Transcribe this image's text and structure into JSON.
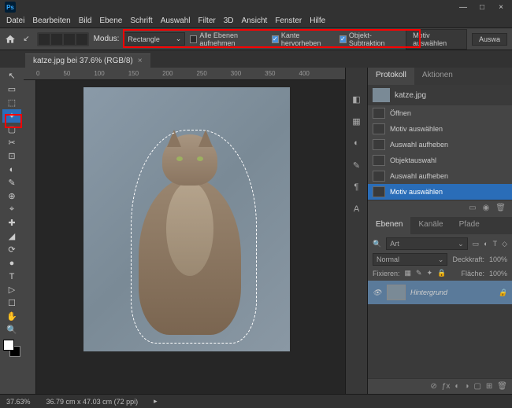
{
  "window": {
    "minimize": "—",
    "maximize": "□",
    "close": "×"
  },
  "menu": [
    "Datei",
    "Bearbeiten",
    "Bild",
    "Ebene",
    "Schrift",
    "Auswahl",
    "Filter",
    "3D",
    "Ansicht",
    "Fenster",
    "Hilfe"
  ],
  "optbar": {
    "mode_label": "Modus:",
    "mode_value": "Rectangle",
    "chk_all": "Alle Ebenen aufnehmen",
    "chk_edge": "Kante hervorheben",
    "chk_sub": "Objekt-Subtraktion",
    "btn_motiv": "Motiv auswählen",
    "btn_ausw": "Auswa"
  },
  "tab": {
    "title": "katze.jpg bei 37.6% (RGB/8)"
  },
  "ruler": [
    "0",
    "50",
    "100",
    "150",
    "200",
    "250",
    "300",
    "350",
    "400"
  ],
  "history": {
    "tabs": [
      "Protokoll",
      "Aktionen"
    ],
    "file": "katze.jpg",
    "items": [
      "Öffnen",
      "Motiv auswählen",
      "Auswahl aufheben",
      "Objektauswahl",
      "Auswahl aufheben",
      "Motiv auswählen"
    ]
  },
  "layers": {
    "tabs": [
      "Ebenen",
      "Kanäle",
      "Pfade"
    ],
    "search": "Art",
    "blend": "Normal",
    "opacity_lbl": "Deckkraft:",
    "opacity": "100%",
    "lock_lbl": "Fixieren:",
    "fill_lbl": "Fläche:",
    "fill": "100%",
    "bg": "Hintergrund"
  },
  "status": {
    "zoom": "37.63%",
    "dims": "36.79 cm x 47.03 cm (72 ppi)"
  },
  "tools": [
    "↖",
    "▭",
    "⬚",
    "✦",
    "▢",
    "✂",
    "⊡",
    "◐",
    "✎",
    "⊕",
    "⌖",
    "✚",
    "◢",
    "⟳",
    "●",
    "T",
    "▷",
    "☐",
    "✋",
    "🔍"
  ]
}
